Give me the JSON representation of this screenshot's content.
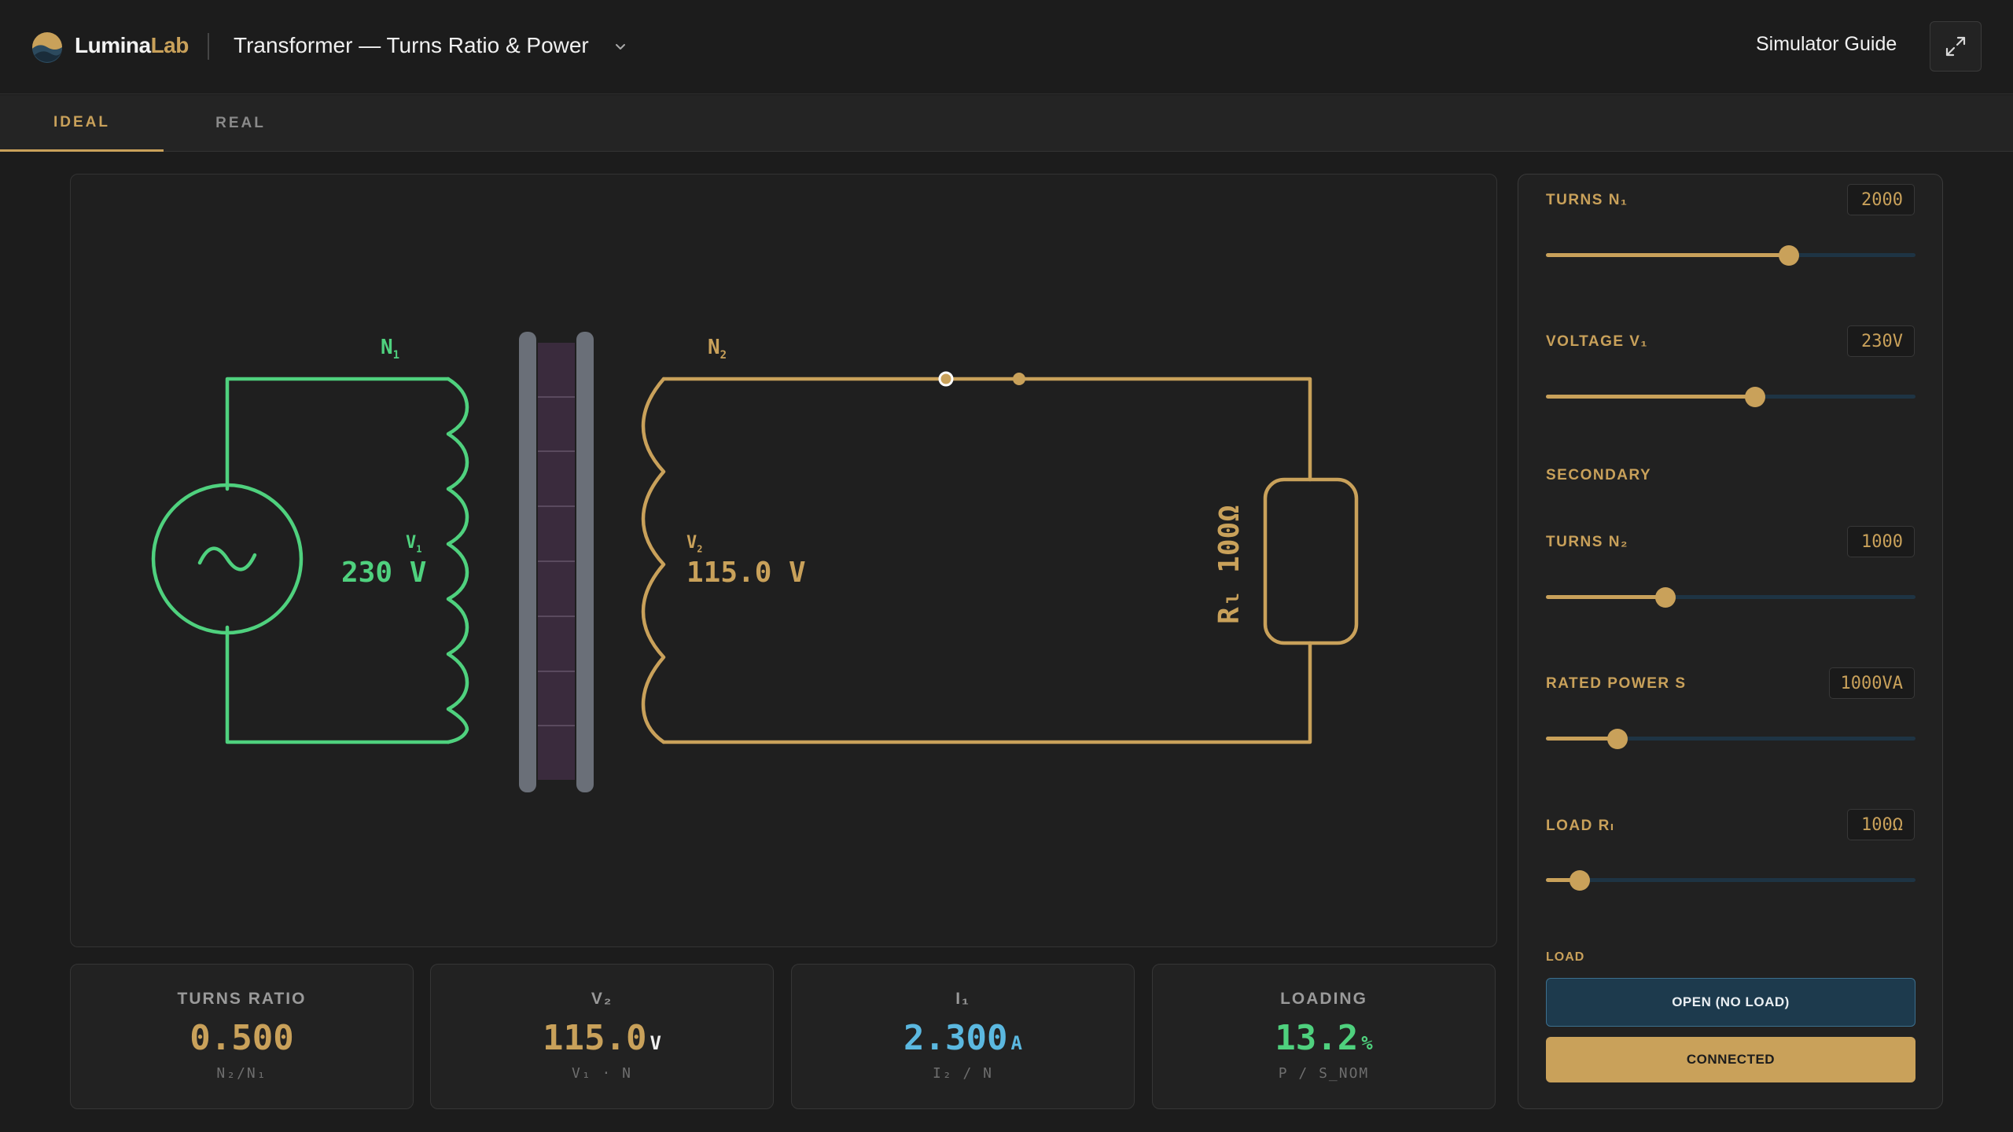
{
  "app": {
    "brand_part1": "Lumina",
    "brand_part2": "Lab",
    "title": "Transformer — Turns Ratio & Power",
    "guide_label": "Simulator Guide"
  },
  "tabs": [
    {
      "label": "IDEAL",
      "active": true
    },
    {
      "label": "REAL",
      "active": false
    }
  ],
  "circuit": {
    "n1_label": "N",
    "n1_sub": "1",
    "n2_label": "N",
    "n2_sub": "2",
    "v1_label": "V",
    "v1_sub": "1",
    "v1_value": "230 V",
    "v2_label": "V",
    "v2_sub": "2",
    "v2_value": "115.0 V",
    "load_label": "Rₗ 100Ω",
    "primary_color": "#4fd17e",
    "secondary_color": "#c9a15a"
  },
  "stats": [
    {
      "title": "TURNS RATIO",
      "value": "0.500",
      "unit": "",
      "sub": "N₂/N₁",
      "color": "#c9a15a"
    },
    {
      "title": "V₂",
      "value": "115.0",
      "unit": "V",
      "sub": "V₁ · N",
      "color": "#c9a15a"
    },
    {
      "title": "I₁",
      "value": "2.300",
      "unit": "A",
      "sub": "I₂ / N",
      "color": "#5bb8e0"
    },
    {
      "title": "LOADING",
      "value": "13.2",
      "unit": "%",
      "sub": "P / S_NOM",
      "color": "#4fd17e"
    }
  ],
  "controls": {
    "turns_n1": {
      "label": "TURNS N₁",
      "value": "2000",
      "fraction": 0.657
    },
    "voltage_v1": {
      "label": "VOLTAGE V₁",
      "value": "230V",
      "fraction": 0.567
    },
    "secondary_heading": "SECONDARY",
    "turns_n2": {
      "label": "TURNS N₂",
      "value": "1000",
      "fraction": 0.324
    },
    "rated_power": {
      "label": "RATED POWER S",
      "value": "1000VA",
      "fraction": 0.193
    },
    "load_r": {
      "label": "LOAD Rₗ",
      "value": "100Ω",
      "fraction": 0.092
    },
    "load_heading": "LOAD",
    "open_button": "OPEN (NO LOAD)",
    "connected_button": "CONNECTED"
  },
  "colors": {
    "accent": "#c9a15a",
    "primary_coil": "#4fd17e",
    "current": "#5bb8e0",
    "track": "#1e3444"
  }
}
